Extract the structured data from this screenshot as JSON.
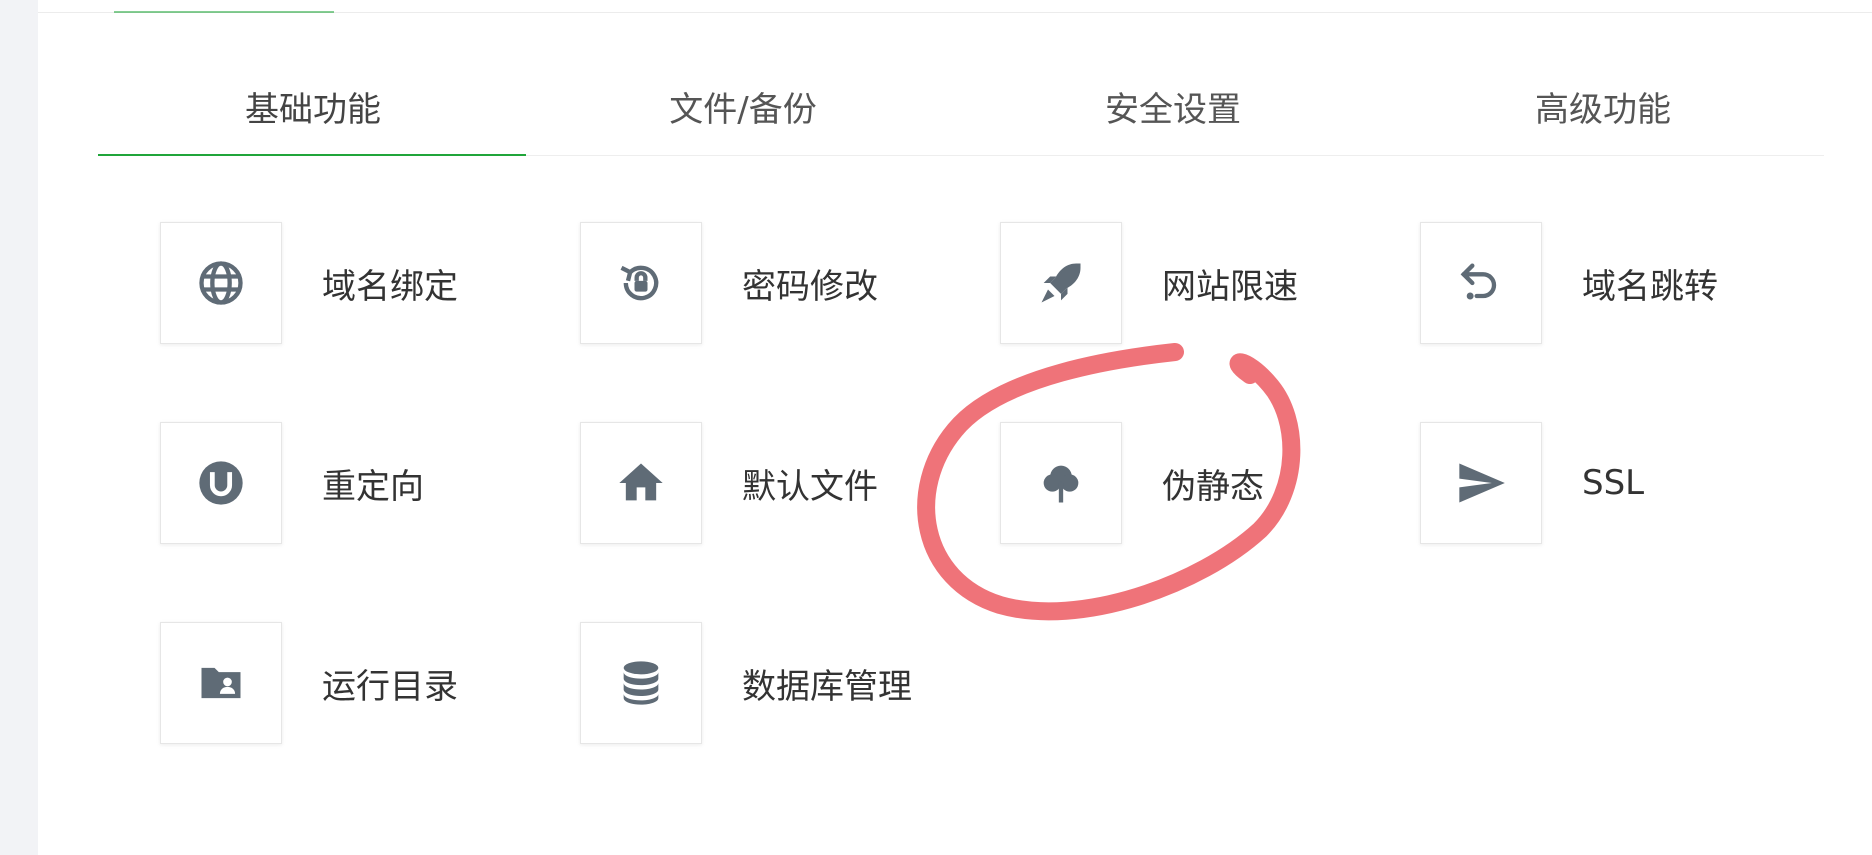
{
  "tabs": [
    {
      "label": "基础功能",
      "active": true
    },
    {
      "label": "文件/备份",
      "active": false
    },
    {
      "label": "安全设置",
      "active": false
    },
    {
      "label": "高级功能",
      "active": false
    }
  ],
  "items": [
    {
      "label": "域名绑定",
      "icon": "globe-icon"
    },
    {
      "label": "密码修改",
      "icon": "lock-reset-icon"
    },
    {
      "label": "网站限速",
      "icon": "rocket-icon"
    },
    {
      "label": "域名跳转",
      "icon": "undo-arrow-icon"
    },
    {
      "label": "重定向",
      "icon": "magnet-icon"
    },
    {
      "label": "默认文件",
      "icon": "home-icon"
    },
    {
      "label": "伪静态",
      "icon": "tree-icon"
    },
    {
      "label": "SSL",
      "icon": "send-icon"
    },
    {
      "label": "运行目录",
      "icon": "folder-user-icon"
    },
    {
      "label": "数据库管理",
      "icon": "database-icon"
    }
  ],
  "colors": {
    "accent": "#20a53a",
    "icon": "#5f6b76",
    "annotation": "#ee6b72"
  }
}
